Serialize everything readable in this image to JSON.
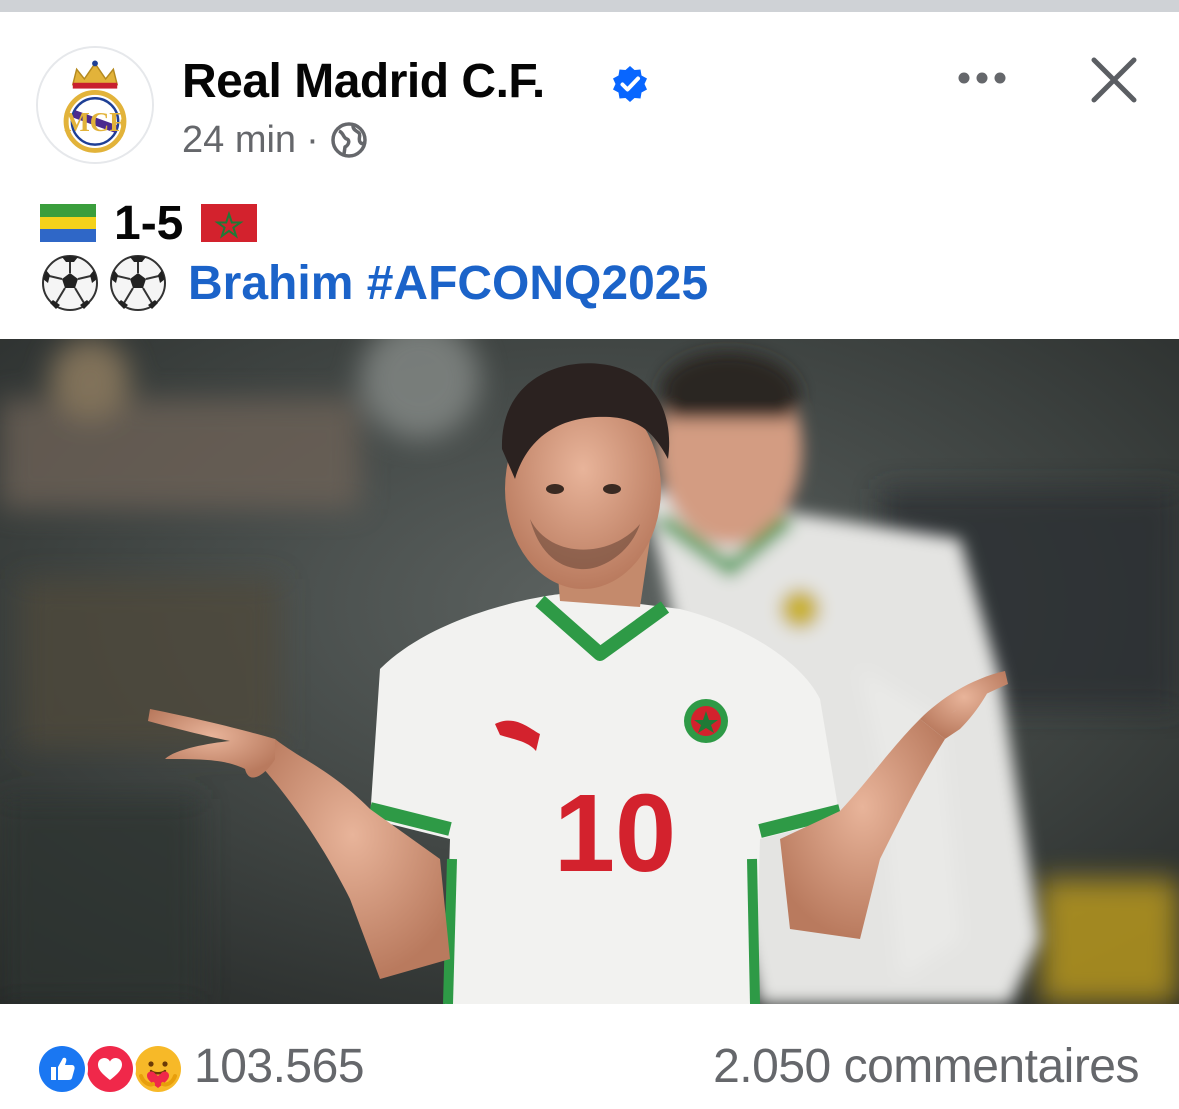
{
  "post": {
    "page_name": "Real Madrid C.F.",
    "time_ago": "24 min",
    "separator": "·",
    "privacy_icon": "globe-icon",
    "verified_icon": "verified-badge-icon",
    "more_icon": "more-options-icon",
    "close_icon": "close-icon",
    "text": {
      "score": "1-5",
      "home_flag": "gabon-flag",
      "away_flag": "morocco-flag",
      "ball_emojis": [
        "soccer-ball",
        "soccer-ball"
      ],
      "hashtag_line": "Brahim #AFCONQ2025"
    },
    "photo": {
      "jersey_number": "10"
    }
  },
  "engagement": {
    "reaction_icons": [
      "like-icon",
      "love-icon",
      "care-icon"
    ],
    "reaction_count": "103.565",
    "comments": "2.050 commentaires"
  },
  "colors": {
    "link": "#1b63c9",
    "secondary_text": "#65676b",
    "verified": "#0866ff"
  }
}
